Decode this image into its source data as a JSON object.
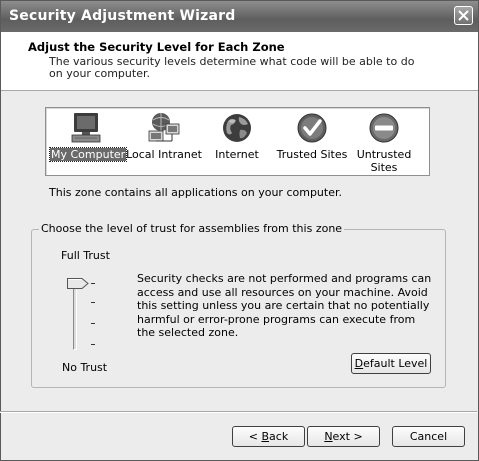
{
  "window": {
    "title": "Security Adjustment Wizard"
  },
  "header": {
    "title": "Adjust the Security Level for Each Zone",
    "subtitle": "The various security levels determine what code will be able to do on your computer."
  },
  "zones": [
    {
      "label": "My Computer",
      "icon": "my-computer-icon",
      "selected": true
    },
    {
      "label": "Local Intranet",
      "icon": "local-intranet-icon",
      "selected": false
    },
    {
      "label": "Internet",
      "icon": "internet-globe-icon",
      "selected": false
    },
    {
      "label": "Trusted Sites",
      "icon": "trusted-sites-checkmark-icon",
      "selected": false
    },
    {
      "label": "Untrusted Sites",
      "icon": "untrusted-sites-minus-icon",
      "selected": false
    }
  ],
  "zone_description": "This zone contains all applications on your computer.",
  "trust_group": {
    "legend": "Choose the level of trust for assemblies from this zone",
    "top_label": "Full Trust",
    "bottom_label": "No Trust",
    "slider_level": "Full Trust",
    "description": "Security checks are not performed and programs can access and use all resources on your machine.  Avoid this setting unless you are certain that no potentially harmful or error-prone programs can execute from the selected zone."
  },
  "buttons": {
    "default_level": {
      "pre": "",
      "mnemonic": "D",
      "post": "efault Level"
    },
    "back": {
      "pre": "< ",
      "mnemonic": "B",
      "post": "ack"
    },
    "next": {
      "pre": "",
      "mnemonic": "N",
      "post": "ext >"
    },
    "cancel": "Cancel"
  }
}
